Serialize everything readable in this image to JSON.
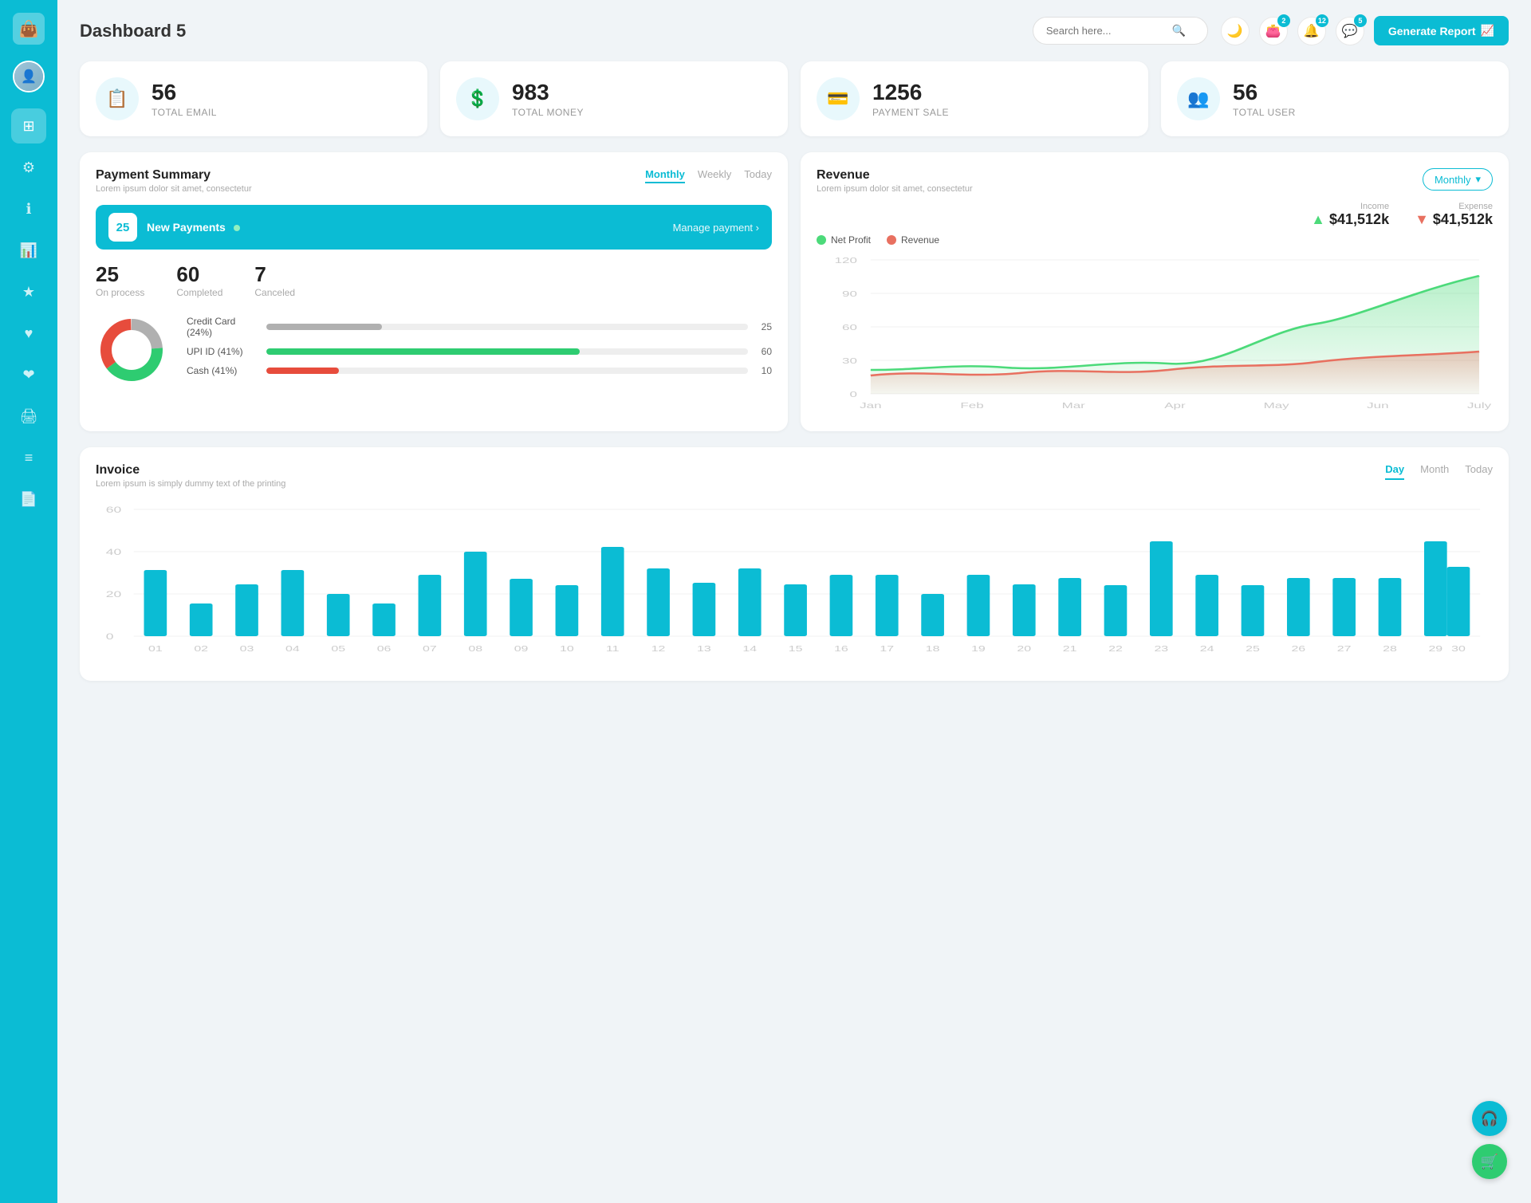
{
  "app": {
    "title": "Dashboard 5"
  },
  "header": {
    "search_placeholder": "Search here...",
    "generate_report_label": "Generate Report",
    "badges": {
      "wallet": "2",
      "bell": "12",
      "chat": "5"
    }
  },
  "stats": [
    {
      "id": "total-email",
      "value": "56",
      "label": "TOTAL EMAIL",
      "icon": "📋"
    },
    {
      "id": "total-money",
      "value": "983",
      "label": "TOTAL MONEY",
      "icon": "💲"
    },
    {
      "id": "payment-sale",
      "value": "1256",
      "label": "PAYMENT SALE",
      "icon": "💳"
    },
    {
      "id": "total-user",
      "value": "56",
      "label": "TOTAL USER",
      "icon": "👥"
    }
  ],
  "payment_summary": {
    "title": "Payment Summary",
    "subtitle": "Lorem ipsum dolor sit amet, consectetur",
    "tabs": [
      "Monthly",
      "Weekly",
      "Today"
    ],
    "active_tab": "Monthly",
    "new_payments_count": "25",
    "new_payments_label": "New Payments",
    "manage_payment_label": "Manage payment",
    "stats": [
      {
        "value": "25",
        "label": "On process"
      },
      {
        "value": "60",
        "label": "Completed"
      },
      {
        "value": "7",
        "label": "Canceled"
      }
    ],
    "progress_rows": [
      {
        "label": "Credit Card (24%)",
        "percent": 24,
        "value": "25",
        "color": "#b0b0b0"
      },
      {
        "label": "UPI ID (41%)",
        "percent": 65,
        "value": "60",
        "color": "#2ecc71"
      },
      {
        "label": "Cash (41%)",
        "percent": 15,
        "value": "10",
        "color": "#e74c3c"
      }
    ]
  },
  "revenue": {
    "title": "Revenue",
    "subtitle": "Lorem ipsum dolor sit amet, consectetur",
    "dropdown": "Monthly",
    "income": {
      "label": "Income",
      "value": "$41,512k"
    },
    "expense": {
      "label": "Expense",
      "value": "$41,512k"
    },
    "legend": [
      {
        "label": "Net Profit",
        "color": "#4cda7a"
      },
      {
        "label": "Revenue",
        "color": "#e87060"
      }
    ],
    "x_labels": [
      "Jan",
      "Feb",
      "Mar",
      "Apr",
      "May",
      "Jun",
      "July"
    ],
    "y_labels": [
      "120",
      "90",
      "60",
      "30",
      "0"
    ]
  },
  "invoice": {
    "title": "Invoice",
    "subtitle": "Lorem ipsum is simply dummy text of the printing",
    "tabs": [
      "Day",
      "Month",
      "Today"
    ],
    "active_tab": "Day",
    "y_labels": [
      "60",
      "40",
      "20",
      "0"
    ],
    "x_labels": [
      "01",
      "02",
      "03",
      "04",
      "05",
      "06",
      "07",
      "08",
      "09",
      "10",
      "11",
      "12",
      "13",
      "14",
      "15",
      "16",
      "17",
      "18",
      "19",
      "20",
      "21",
      "22",
      "23",
      "24",
      "25",
      "26",
      "27",
      "28",
      "29",
      "30"
    ],
    "bars": [
      35,
      14,
      22,
      35,
      20,
      14,
      30,
      40,
      27,
      24,
      42,
      33,
      25,
      33,
      22,
      30,
      30,
      20,
      30,
      22,
      28,
      24,
      45,
      30,
      24,
      28,
      28,
      28,
      45,
      35
    ]
  },
  "sidebar": {
    "items": [
      {
        "id": "wallet",
        "icon": "💼",
        "active": false
      },
      {
        "id": "dashboard",
        "icon": "⊞",
        "active": true
      },
      {
        "id": "settings",
        "icon": "⚙",
        "active": false
      },
      {
        "id": "info",
        "icon": "ℹ",
        "active": false
      },
      {
        "id": "chart",
        "icon": "📊",
        "active": false
      },
      {
        "id": "star",
        "icon": "★",
        "active": false
      },
      {
        "id": "heart1",
        "icon": "♥",
        "active": false
      },
      {
        "id": "heart2",
        "icon": "❤",
        "active": false
      },
      {
        "id": "printer",
        "icon": "🖨",
        "active": false
      },
      {
        "id": "list",
        "icon": "≡",
        "active": false
      },
      {
        "id": "document",
        "icon": "📄",
        "active": false
      }
    ]
  },
  "fabs": [
    {
      "id": "headset",
      "icon": "🎧",
      "color": "teal"
    },
    {
      "id": "cart",
      "icon": "🛒",
      "color": "green"
    }
  ]
}
